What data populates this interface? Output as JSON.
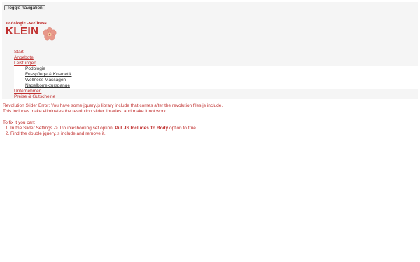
{
  "toggle": {
    "label": "Toggle navigation"
  },
  "logo": {
    "top_line": "Podologie -Wellness",
    "brand": "KLEIN",
    "colors": {
      "brand": "#c0302f",
      "flower": "#e8988a"
    }
  },
  "nav": {
    "items": [
      {
        "label": "Start"
      },
      {
        "label": "Angebote"
      },
      {
        "label": "Leistungen"
      },
      {
        "label": "Unternehmen"
      },
      {
        "label": "Preise & Gutscheine"
      }
    ],
    "submenu": [
      {
        "label": "Podologie"
      },
      {
        "label": "Fusspflege & Kosmetik"
      },
      {
        "label": "Wellness Massagen"
      },
      {
        "label": "Nagelkorrekturspange"
      }
    ]
  },
  "error": {
    "line1": "Revolution Slider Error: You have some jquery.js library include that comes after the revolution files js include.",
    "line2": "This includes make eliminates the revolution slider libraries, and make it not work.",
    "fix_intro": "To fix it you can:",
    "step1_pre": "In the Slider Settings -> Troubleshooting set option: ",
    "step1_bold": "Put JS Includes To Body",
    "step1_post": " option to true.",
    "step2": "Find the double jquery.js include and remove it."
  }
}
